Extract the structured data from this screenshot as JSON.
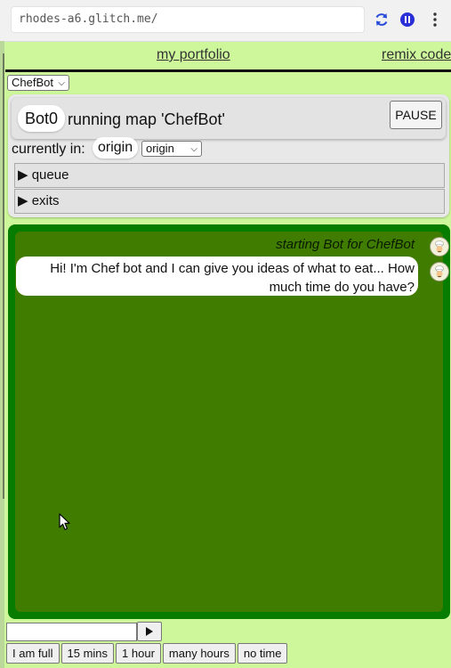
{
  "browser": {
    "url": "rhodes-a6.glitch.me/",
    "icons": [
      "refresh-icon",
      "pause-icon",
      "kebab-menu-icon"
    ]
  },
  "nav": {
    "portfolio_link": "my portfolio",
    "remix_link": "remix code"
  },
  "map_select": {
    "selected": "ChefBot"
  },
  "bot_panel": {
    "bot_name": "Bot0",
    "running_text": "running map 'ChefBot'",
    "pause_label": "PAUSE",
    "currently_in_label": "currently in:",
    "current_state": "origin",
    "state_select": "origin",
    "queue_label": "queue",
    "exits_label": "exits"
  },
  "chat": {
    "start_message": "starting Bot for ChefBot",
    "bot_message": "Hi! I'm Chef bot and I can give you ideas of what to eat... How much time do you have?",
    "input_value": "",
    "quick_replies": [
      "I am full",
      "15 mins",
      "1 hour",
      "many hours",
      "no time"
    ]
  },
  "colors": {
    "page_background": "#cdf79a",
    "chat_border": "#067d00",
    "chat_background": "#3f7c00"
  }
}
